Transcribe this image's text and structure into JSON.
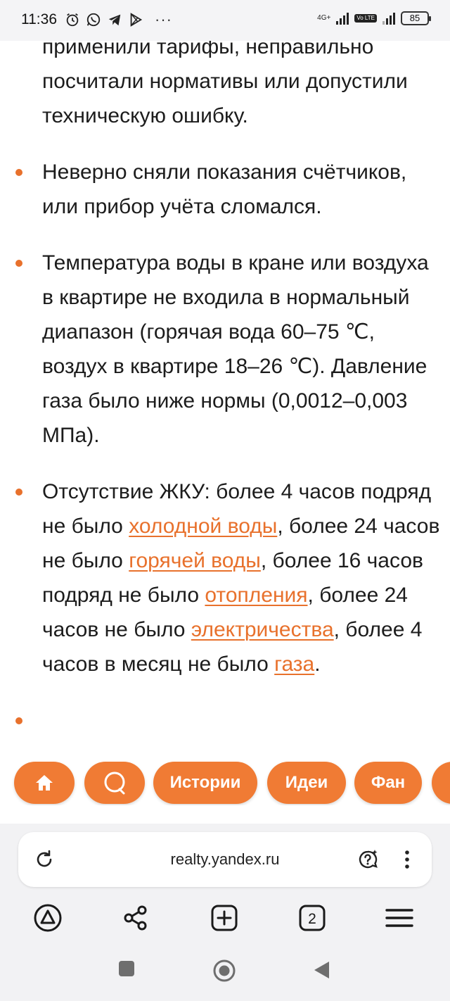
{
  "status_bar": {
    "time": "11:36",
    "network": "4G+",
    "volte": "Vo LTE",
    "battery": "85"
  },
  "article": {
    "p0": "применили тарифы, неправильно посчитали нормативы или допустили техническую ошибку.",
    "p1": "Неверно сняли показания счётчиков, или прибор учёта сломался.",
    "p2": "Температура воды в кране или воздуха в квартире не входила в нормальный диапазон (горячая вода 60–75 ℃, воздух в квартире 18–26 ℃). Давление газа было ниже нормы (0,0012–0,003 МПа).",
    "p3": {
      "t1": "Отсутствие ЖКУ: более 4 часов подряд не было ",
      "l1": "холодной воды",
      "t2": ", более 24 часов не было ",
      "l2": "горячей воды",
      "t3": ", более 16 часов подряд не было ",
      "l3": "отопления",
      "t4": ", более 24 часов не было ",
      "l4": "электричества",
      "t5": ", более 4 часов в месяц не было ",
      "l5": "газа",
      "t6": "."
    }
  },
  "pills": {
    "stories": "Истории",
    "ideas": "Идеи",
    "fan": "Фан"
  },
  "address_bar": {
    "url": "realty.yandex.ru"
  },
  "colors": {
    "accent": "#f07b34",
    "link": "#e8712c"
  }
}
